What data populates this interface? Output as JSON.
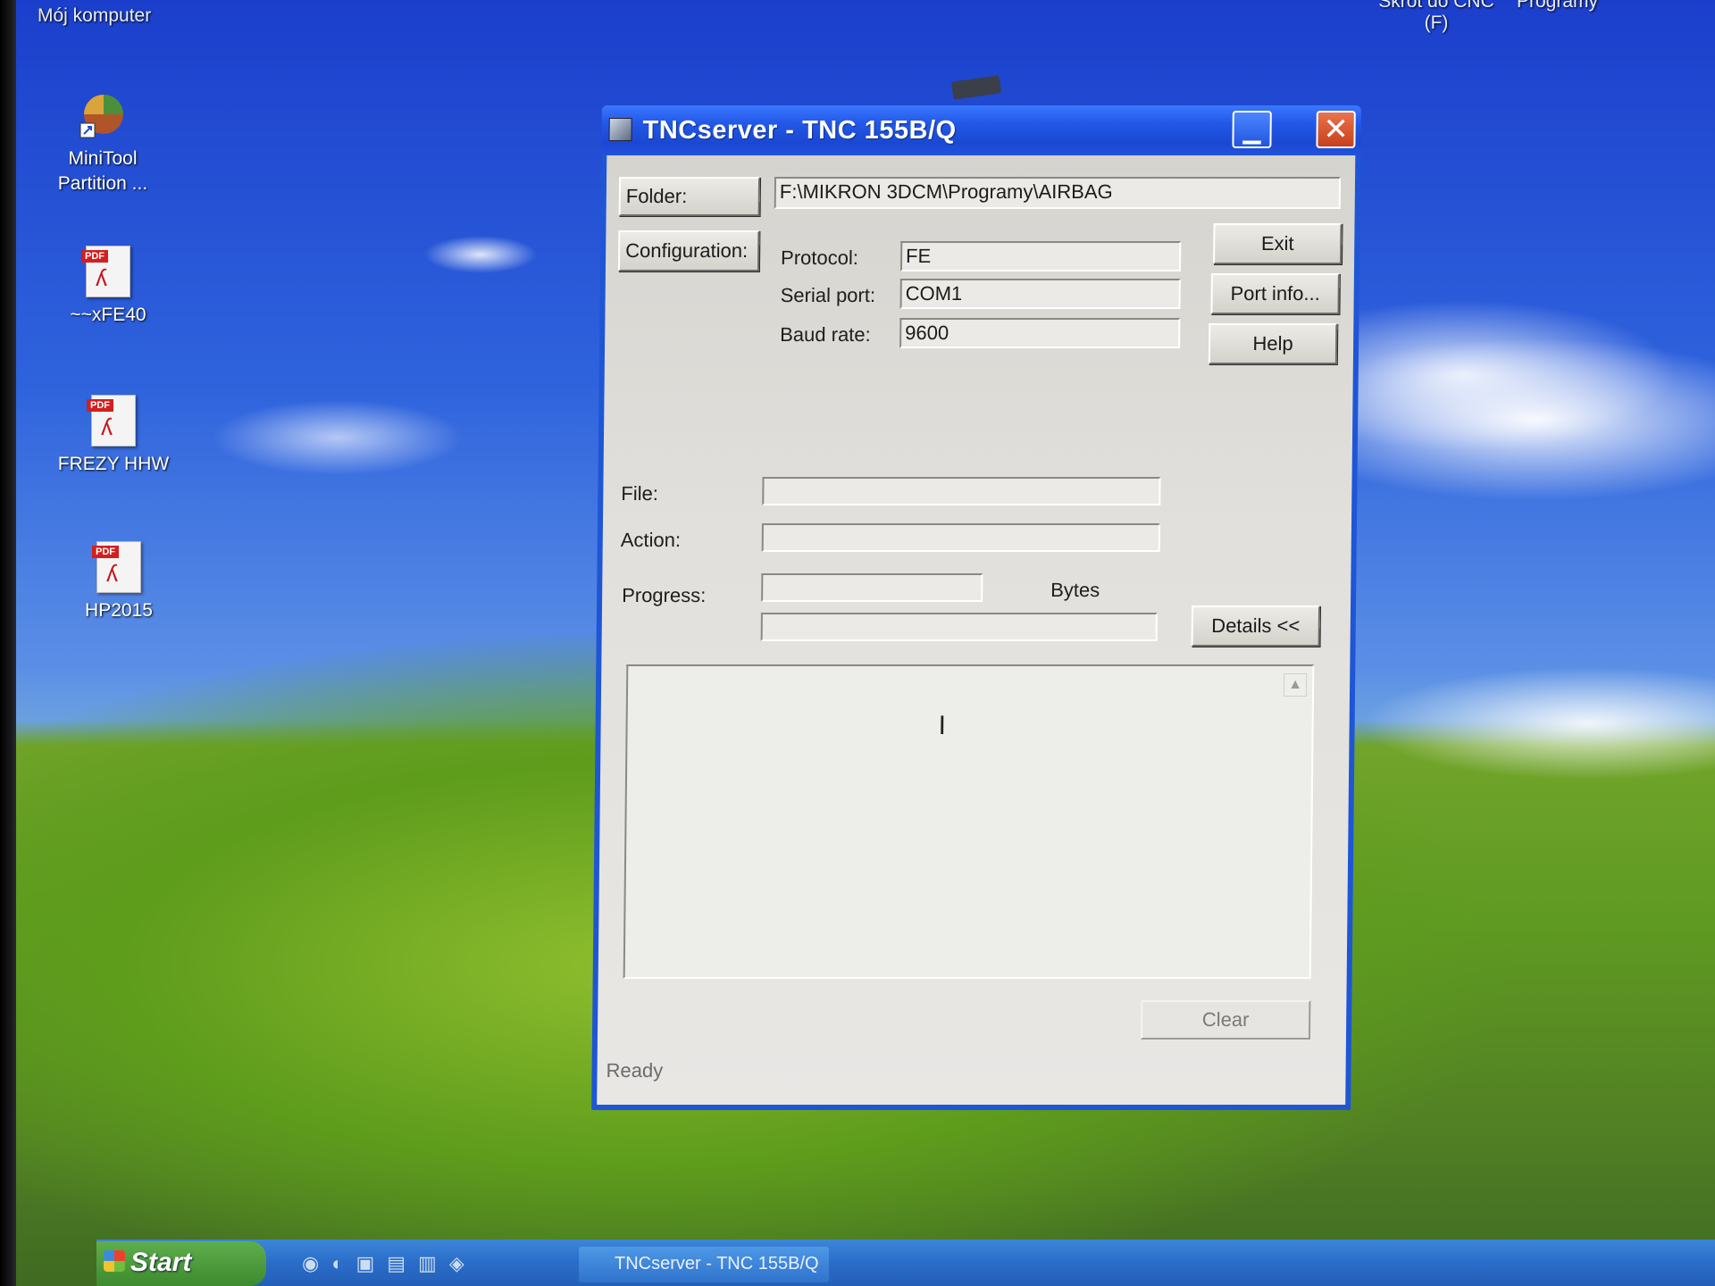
{
  "desktop": {
    "top_labels": {
      "my_computer": "Mój komputer",
      "cnc_shortcut_line1": "Skrót do CNC",
      "cnc_shortcut_line2": "(F)",
      "programs": "Programy"
    },
    "icons": [
      {
        "name": "minitool-icon",
        "label_line1": "MiniTool",
        "label_line2": "Partition ..."
      },
      {
        "name": "pdf-icon",
        "label_line1": "~~xFE40",
        "label_line2": ""
      },
      {
        "name": "pdf-icon",
        "label_line1": "FREZY HHW",
        "label_line2": ""
      },
      {
        "name": "pdf-icon",
        "label_line1": "HP2015",
        "label_line2": ""
      }
    ],
    "pdf_tag": "PDF"
  },
  "window": {
    "title": "TNCserver - TNC 155B/Q",
    "minimize_glyph": "▁",
    "close_glyph": "✕",
    "folder_button": "Folder:",
    "folder_path": "F:\\MIKRON 3DCM\\Programy\\AIRBAG",
    "configuration_button": "Configuration:",
    "protocol_label": "Protocol:",
    "protocol_value": "FE",
    "serial_port_label": "Serial port:",
    "serial_port_value": "COM1",
    "baud_rate_label": "Baud rate:",
    "baud_rate_value": "9600",
    "exit_button": "Exit",
    "port_info_button": "Port info...",
    "help_button": "Help",
    "file_label": "File:",
    "file_value": "",
    "action_label": "Action:",
    "action_value": "",
    "progress_label": "Progress:",
    "bytes_label": "Bytes",
    "details_button": "Details <<",
    "clear_button": "Clear",
    "status_text": "Ready",
    "scroll_up_glyph": "▲",
    "text_cursor_glyph": "I"
  },
  "taskbar": {
    "start_label": "Start",
    "task_label": "TNCserver - TNC 155B/Q"
  }
}
